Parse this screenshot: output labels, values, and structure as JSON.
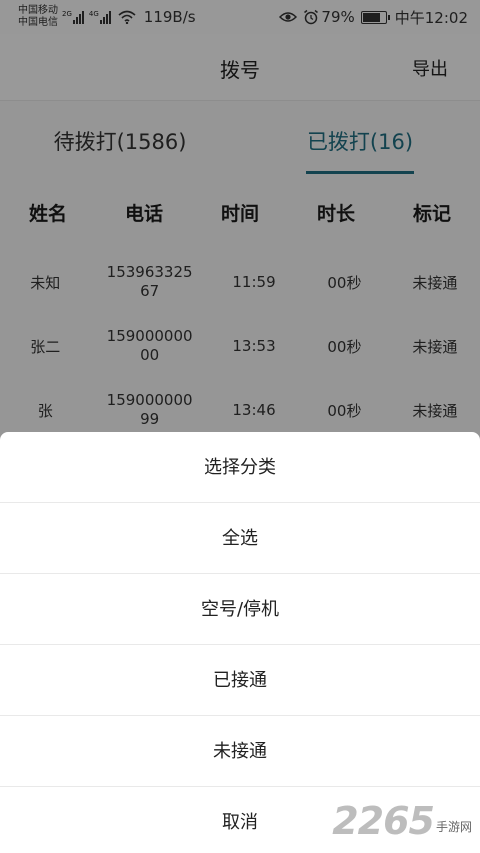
{
  "status_bar": {
    "carrier1": "中国移动",
    "carrier2": "中国电信",
    "net1": "2G",
    "net2": "4G",
    "speed": "119B/s",
    "battery_percent": "79%",
    "battery_level": 0.79,
    "time": "中午12:02"
  },
  "header": {
    "title": "拨号",
    "export_label": "导出"
  },
  "tabs": [
    {
      "label": "待拨打(1586)",
      "active": false
    },
    {
      "label": "已拨打(16)",
      "active": true
    }
  ],
  "table": {
    "columns": [
      "姓名",
      "电话",
      "时间",
      "时长",
      "标记"
    ],
    "rows": [
      {
        "name": "未知",
        "phone": "15396332567",
        "time": "11:59",
        "duration": "00秒",
        "mark": "未接通"
      },
      {
        "name": "张二",
        "phone": "15900000000",
        "time": "13:53",
        "duration": "00秒",
        "mark": "未接通"
      },
      {
        "name": "张",
        "phone": "15900000099",
        "time": "13:46",
        "duration": "00秒",
        "mark": "未接通"
      }
    ]
  },
  "sheet": {
    "items": [
      "选择分类",
      "全选",
      "空号/停机",
      "已接通",
      "未接通",
      "取消"
    ]
  },
  "watermark": {
    "number": "2265",
    "text": "手游网"
  },
  "colors": {
    "accent": "#1f6c80",
    "overlay": "rgba(0,0,0,0.38)"
  }
}
